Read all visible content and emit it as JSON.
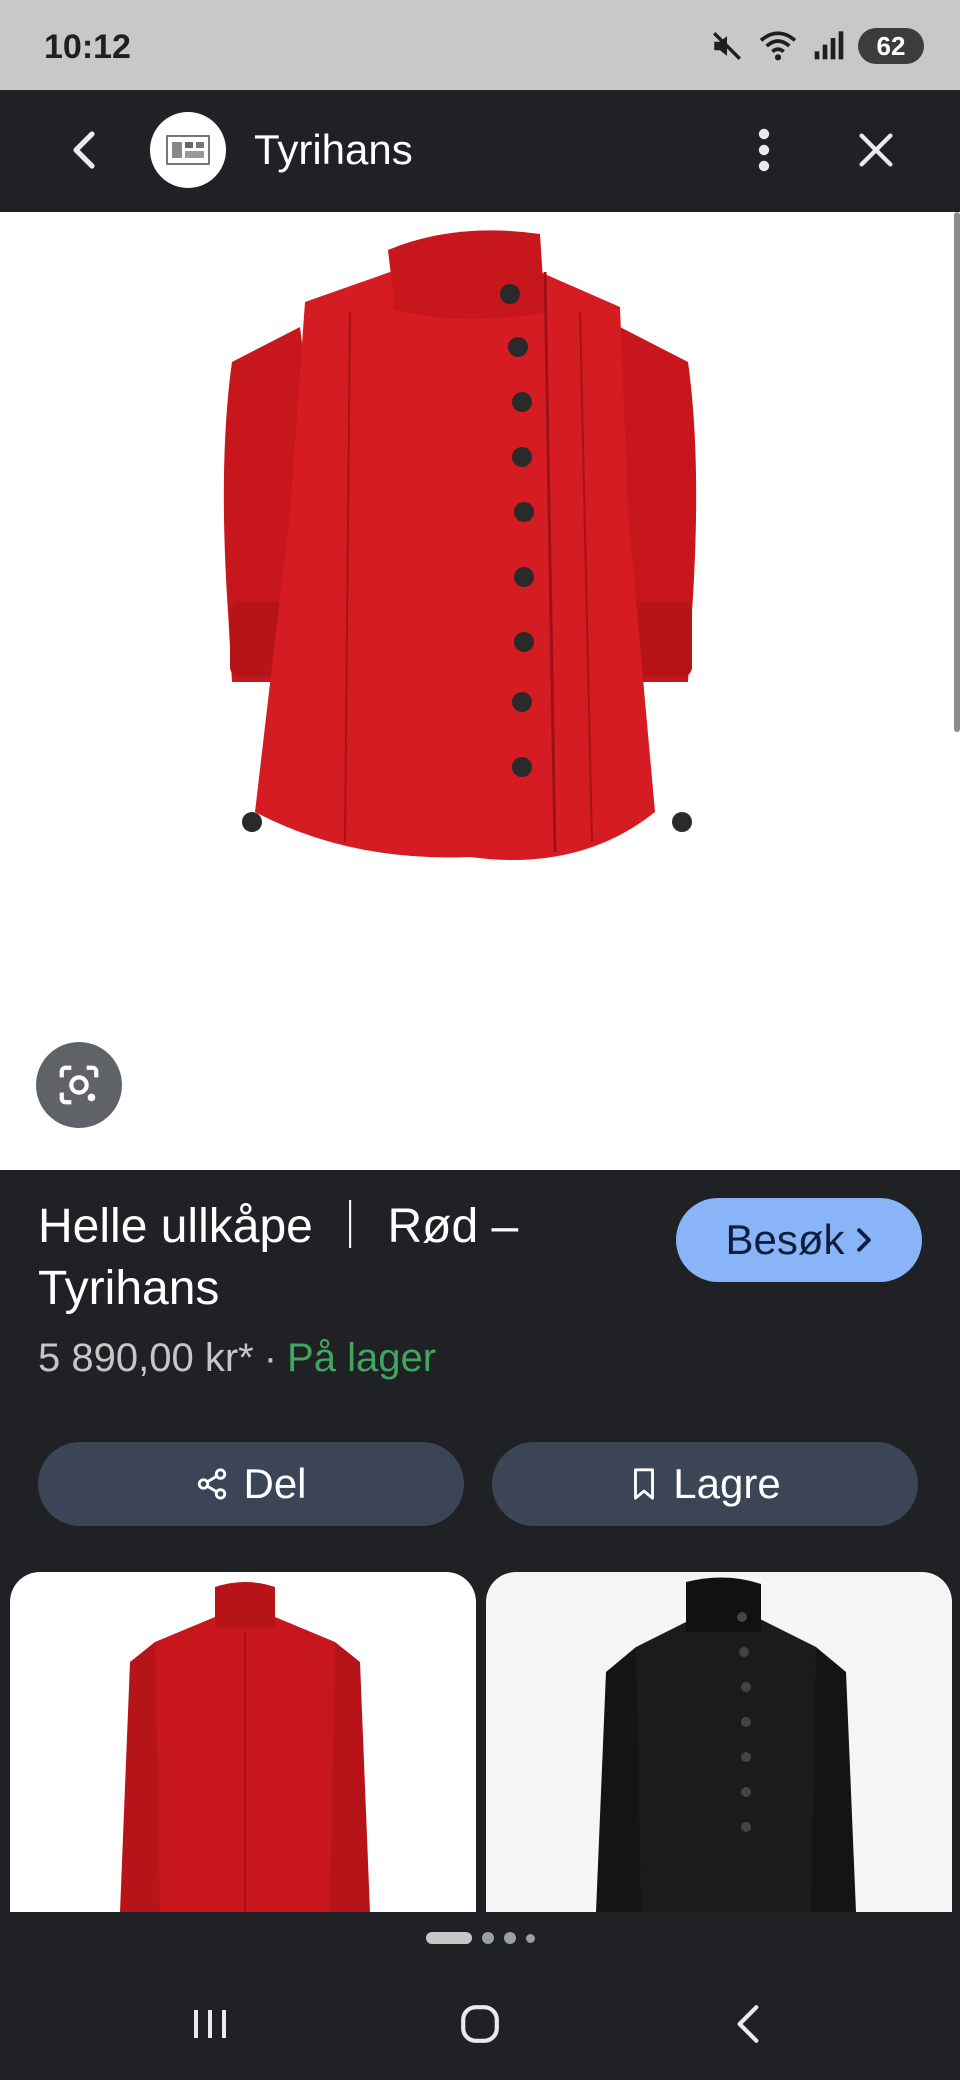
{
  "status_bar": {
    "time": "10:12",
    "battery": "62",
    "icons": [
      "mute-icon",
      "wifi-icon",
      "signal-icon",
      "battery-icon"
    ]
  },
  "header": {
    "site_name": "Tyrihans",
    "icons": [
      "back-icon",
      "site-logo",
      "more-vert-icon",
      "close-icon"
    ]
  },
  "product": {
    "title": "Helle ullkåpe ｜ Rød – Tyrihans",
    "price": "5 890,00 kr*",
    "separator": "·",
    "stock": "På lager",
    "visit_label": "Besøk",
    "coat_color": "#c8161d"
  },
  "actions": {
    "share_label": "Del",
    "save_label": "Lagre"
  },
  "colors": {
    "background": "#202124",
    "accent": "#8ab4f8",
    "in_stock": "#3fa55f",
    "button": "#3c4556"
  },
  "carousel": {
    "page_count": 4,
    "active_page": 1
  }
}
